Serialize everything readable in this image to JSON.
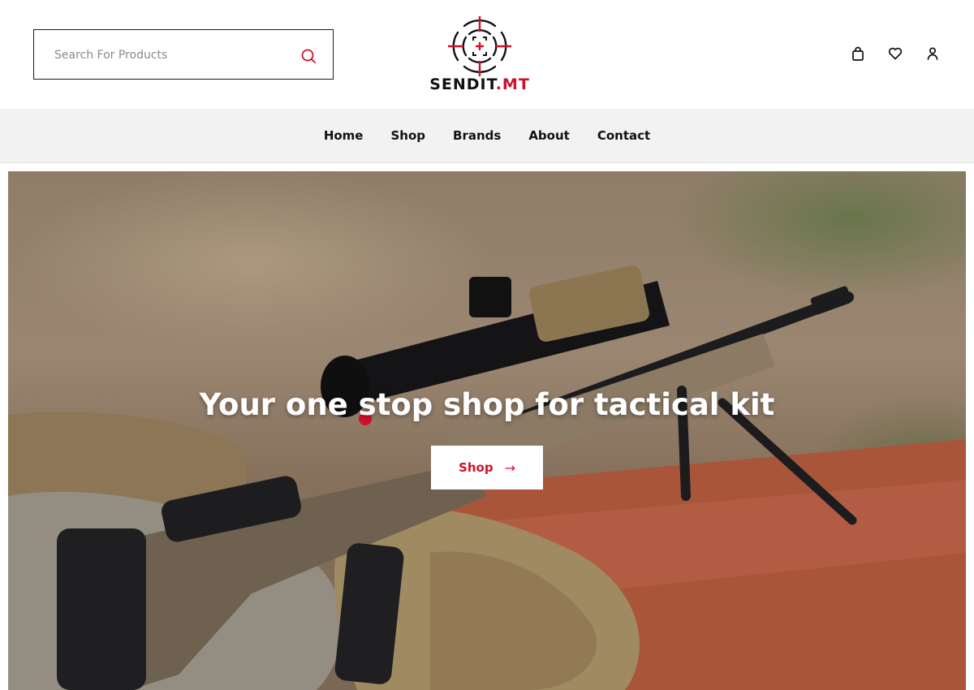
{
  "search": {
    "placeholder": "Search For Products",
    "value": "",
    "icon": "search-icon"
  },
  "brand": {
    "name_main": "SENDIT",
    "name_accent": ".MT",
    "accent_color": "#d0112b",
    "logo_icon": "crosshair-icon"
  },
  "header_icons": [
    {
      "name": "bag-icon"
    },
    {
      "name": "heart-icon"
    },
    {
      "name": "user-icon"
    }
  ],
  "nav": {
    "items": [
      {
        "label": "Home"
      },
      {
        "label": "Shop"
      },
      {
        "label": "Brands"
      },
      {
        "label": "About"
      },
      {
        "label": "Contact"
      }
    ]
  },
  "hero": {
    "title": "Your one stop shop for tactical kit",
    "button_label": "Shop",
    "button_arrow": "→",
    "button_text_color": "#d0112b"
  }
}
